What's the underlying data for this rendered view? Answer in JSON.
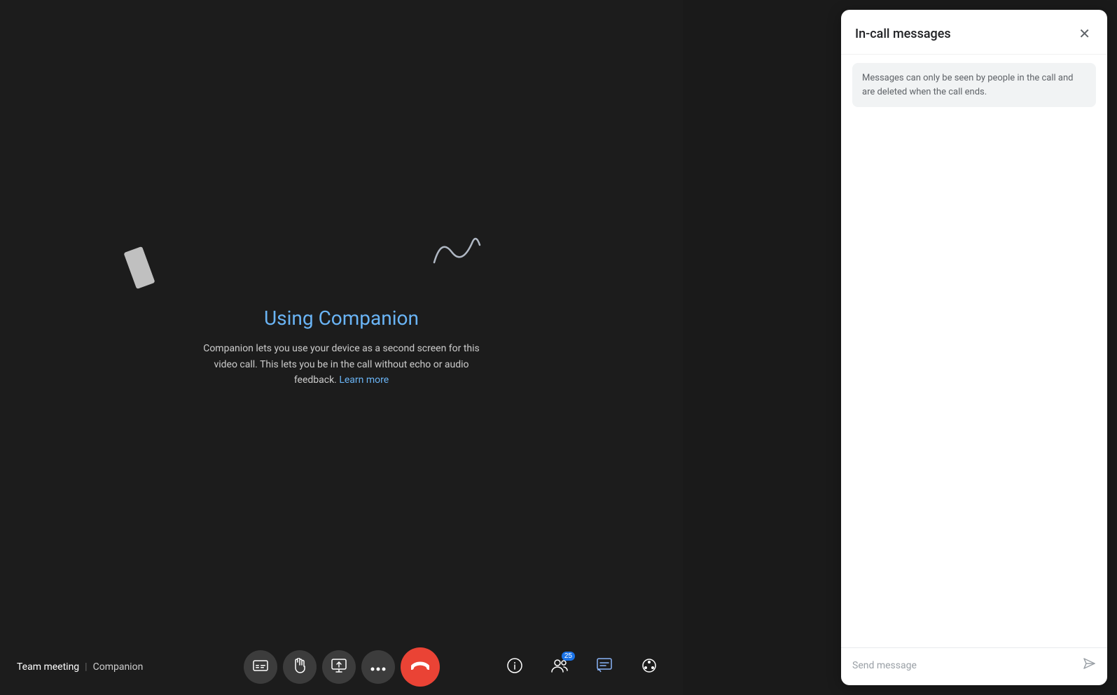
{
  "meeting": {
    "title": "Team meeting",
    "separator": "|",
    "companion_label": "Companion"
  },
  "companion_info": {
    "title": "Using Companion",
    "description_before": "Companion lets you use your device as a second screen for this video call. This lets you be in the call without echo or audio feedback.",
    "learn_more": "Learn more"
  },
  "toolbar": {
    "buttons": [
      {
        "id": "captions",
        "label": "Captions"
      },
      {
        "id": "raise-hand",
        "label": "Raise hand"
      },
      {
        "id": "present",
        "label": "Present"
      },
      {
        "id": "more",
        "label": "More options"
      },
      {
        "id": "end-call",
        "label": "End call"
      }
    ]
  },
  "toolbar_right": {
    "info_label": "Meeting info",
    "people_label": "People",
    "people_badge": "25",
    "chat_label": "Chat",
    "activities_label": "Activities"
  },
  "panel": {
    "title": "In-call messages",
    "close_label": "Close",
    "info_banner": "Messages can only be seen by people in the call and are deleted when the call ends.",
    "send_placeholder": "Send message",
    "send_label": "Send"
  }
}
